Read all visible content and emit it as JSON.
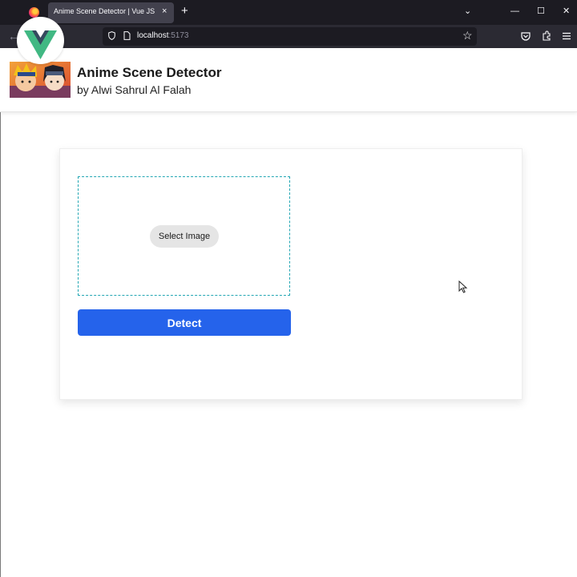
{
  "browser": {
    "tab_title": "Anime Scene Detector | Vue JS",
    "tab_close": "×",
    "new_tab": "+",
    "url_host": "localhost",
    "url_port": ":5173",
    "icons": [
      "firefox-logo",
      "back-arrow-icon",
      "shield-icon",
      "page-icon",
      "star-icon",
      "pocket-icon",
      "extensions-icon",
      "menu-icon",
      "chevron-down-icon",
      "minimize-icon",
      "maximize-icon",
      "close-icon"
    ],
    "window_buttons": {
      "list_all_tabs": "⌄",
      "minimize": "—",
      "maximize": "☐",
      "close": "✕"
    },
    "back": "←",
    "star": "☆"
  },
  "header": {
    "title": "Anime Scene Detector",
    "author": "by Alwi Sahrul Al Falah"
  },
  "upload": {
    "select_label": "Select Image"
  },
  "actions": {
    "detect_label": "Detect"
  },
  "colors": {
    "accent": "#2563eb",
    "dropzone_border": "#22a6b3",
    "vue_green": "#41b883",
    "vue_dark": "#35495e"
  }
}
